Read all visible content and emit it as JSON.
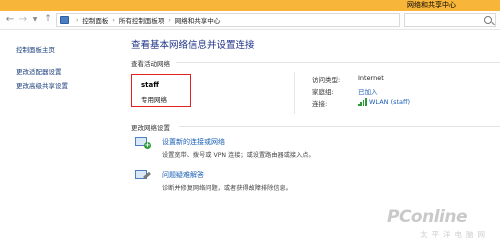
{
  "window": {
    "title": "网络和共享中心"
  },
  "nav": {
    "back_icon": "back-arrow-icon",
    "forward_icon": "forward-arrow-icon",
    "up_icon": "up-arrow-icon",
    "breadcrumb": [
      "控制面板",
      "所有控制面板项",
      "网络和共享中心"
    ],
    "separator": "›"
  },
  "sidebar": {
    "home": "控制面板主页",
    "links": [
      "更改适配器设置",
      "更改高级共享设置"
    ]
  },
  "main": {
    "title": "查看基本网络信息并设置连接",
    "active_section": "查看活动网络",
    "network": {
      "name": "staff",
      "type": "专用网络",
      "access_label": "访问类型:",
      "access_value": "Internet",
      "homegroup_label": "家庭组:",
      "homegroup_value": "已加入",
      "connection_label": "连接:",
      "connection_value": "WLAN (staff)"
    },
    "change_section": "更改网络设置",
    "actions": [
      {
        "title": "设置新的连接或网络",
        "desc": "设置宽带、拨号或 VPN 连接；或设置路由器或接入点。",
        "icon": "network-setup-icon"
      },
      {
        "title": "问题疑难解答",
        "desc": "诊断并修复网络问题，或者获得故障排除信息。",
        "icon": "troubleshoot-icon"
      }
    ]
  },
  "colors": {
    "titlebar": "#f7b53a",
    "link": "#1a5fb4",
    "highlight_box": "#e0231c",
    "heading": "#1e3287"
  },
  "watermark": {
    "logo": "PConline",
    "sub": "太平洋电脑网"
  }
}
